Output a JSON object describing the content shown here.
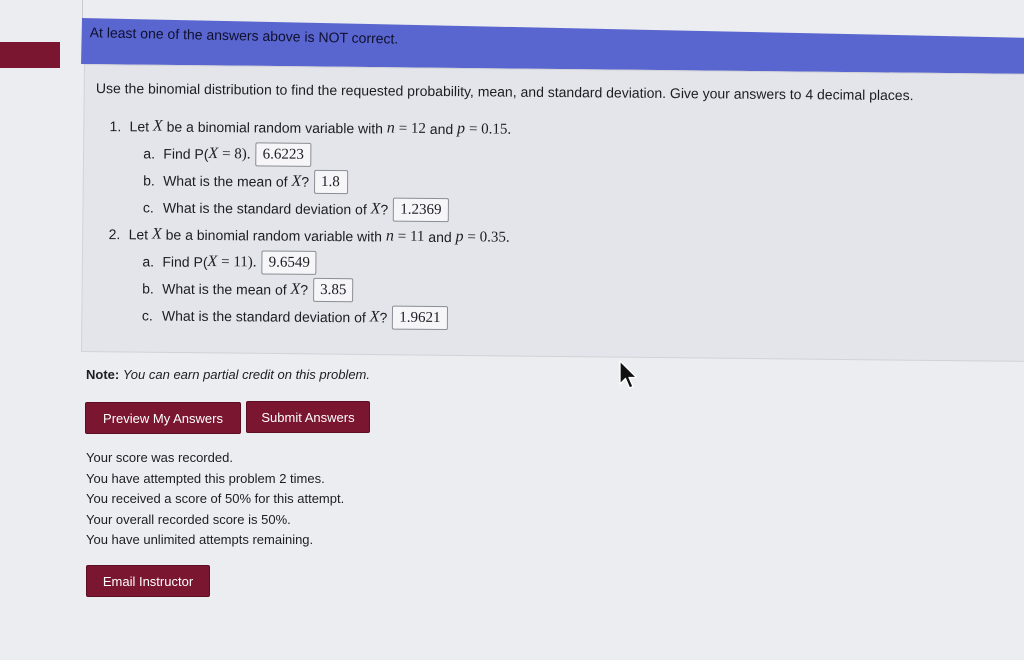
{
  "alert": {
    "message": "At least one of the answers above is NOT correct."
  },
  "problem": {
    "instructions": "Use the binomial distribution to find the requested probability, mean, and standard deviation. Give your answers to 4 decimal places.",
    "q1": {
      "number": "1.",
      "lead": "Let",
      "var": "X",
      "mid": "be a binomial random variable with",
      "n_sym": "n",
      "n_val": "= 12",
      "and": "and",
      "p_sym": "p",
      "p_val": "= 0.15.",
      "a": {
        "letter": "a.",
        "pre": "Find P(",
        "var": "X",
        "rest": "= 8).",
        "answer": "6.6223"
      },
      "b": {
        "letter": "b.",
        "pre": "What is the mean of",
        "var": "X",
        "q": "?",
        "answer": "1.8"
      },
      "c": {
        "letter": "c.",
        "pre": "What is the standard deviation of",
        "var": "X",
        "q": "?",
        "answer": "1.2369"
      }
    },
    "q2": {
      "number": "2.",
      "lead": "Let",
      "var": "X",
      "mid": "be a binomial random variable with",
      "n_sym": "n",
      "n_val": "= 11",
      "and": "and",
      "p_sym": "p",
      "p_val": "= 0.35.",
      "a": {
        "letter": "a.",
        "pre": "Find P(",
        "var": "X",
        "rest": "= 11).",
        "answer": "9.6549"
      },
      "b": {
        "letter": "b.",
        "pre": "What is the mean of",
        "var": "X",
        "q": "?",
        "answer": "3.85"
      },
      "c": {
        "letter": "c.",
        "pre": "What is the standard deviation of",
        "var": "X",
        "q": "?",
        "answer": "1.9621"
      }
    }
  },
  "note": {
    "label": "Note:",
    "text": "You can earn partial credit on this problem."
  },
  "buttons": {
    "preview": "Preview My Answers",
    "submit": "Submit Answers",
    "email": "Email Instructor"
  },
  "status": {
    "line1": "Your score was recorded.",
    "line2": "You have attempted this problem 2 times.",
    "line3": "You received a score of 50% for this attempt.",
    "line4": "Your overall recorded score is 50%.",
    "line5": "You have unlimited attempts remaining."
  },
  "colors": {
    "banner": "#5a66cf",
    "button": "#7a1630"
  },
  "icons": {
    "cursor": "mouse-pointer-icon"
  }
}
